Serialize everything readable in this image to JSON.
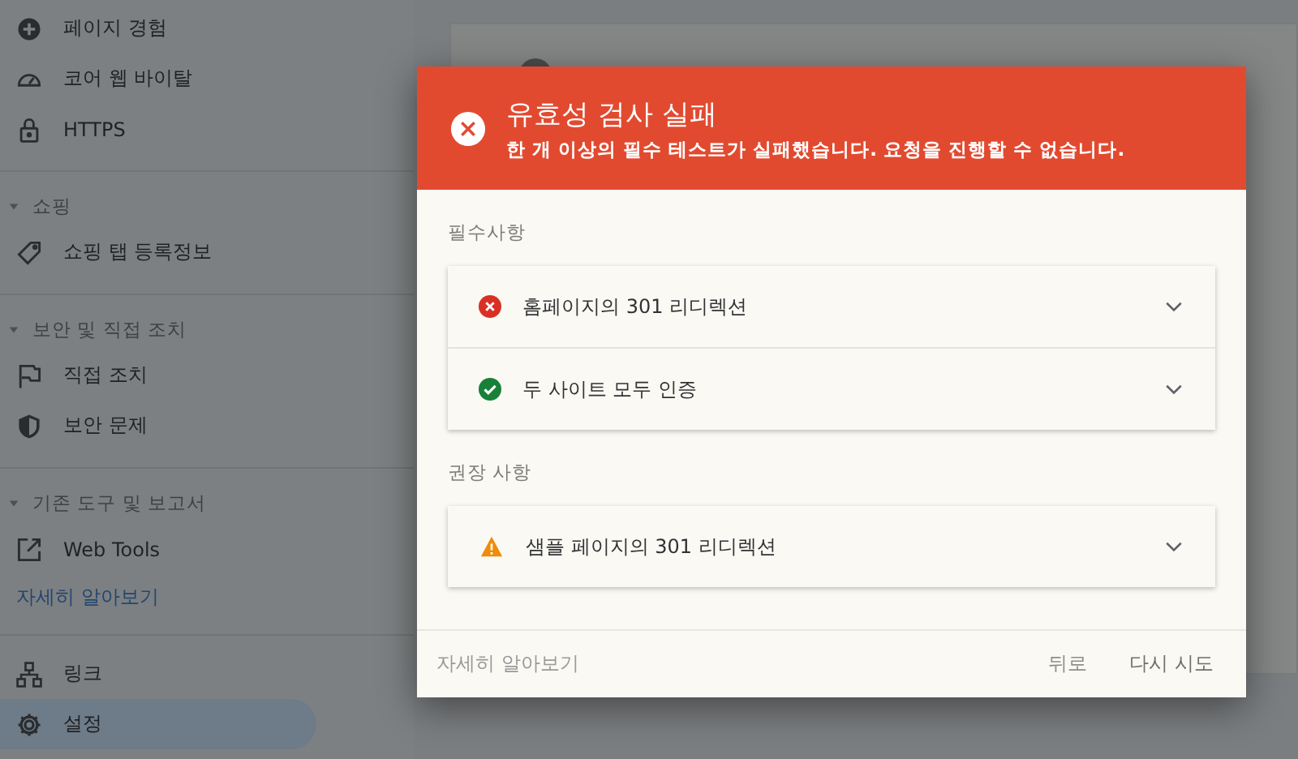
{
  "sidebar": {
    "groups": [
      {
        "items": [
          {
            "label": "페이지 경험",
            "selected": false
          },
          {
            "label": "코어 웹 바이탈",
            "selected": false
          },
          {
            "label": "HTTPS",
            "selected": false
          }
        ]
      },
      {
        "title": "쇼핑",
        "expanded": true,
        "items": [
          {
            "label": "쇼핑 탭 등록정보",
            "selected": false
          }
        ]
      },
      {
        "title": "보안 및 직접 조치",
        "expanded": true,
        "items": [
          {
            "label": "직접 조치",
            "selected": false
          },
          {
            "label": "보안 문제",
            "selected": false
          }
        ]
      },
      {
        "title": "기존 도구 및 보고서",
        "expanded": true,
        "items": [
          {
            "label": "Web Tools",
            "selected": false
          }
        ],
        "link": "자세히 알아보기"
      },
      {
        "items": [
          {
            "label": "링크",
            "selected": false
          },
          {
            "label": "설정",
            "selected": true
          }
        ]
      }
    ]
  },
  "dialog": {
    "title": "유효성 검사 실패",
    "message": "한 개 이상의 필수 테스트가 실패했습니다. 요청을 진행할 수 없습니다.",
    "sections": [
      {
        "heading": "필수사항",
        "checks": [
          {
            "kind": "failed",
            "label": "홈페이지의 301 리디렉션",
            "expanded": false
          },
          {
            "kind": "passed",
            "label": "두 사이트 모두 인증",
            "expanded": false
          }
        ]
      },
      {
        "heading": "권장 사항",
        "checks": [
          {
            "kind": "warning",
            "label": "샘플 페이지의 301 리디렉션",
            "expanded": false
          }
        ]
      }
    ],
    "learn_more": "자세히 알아보기",
    "buttons": [
      "뒤로",
      "다시 시도"
    ]
  }
}
